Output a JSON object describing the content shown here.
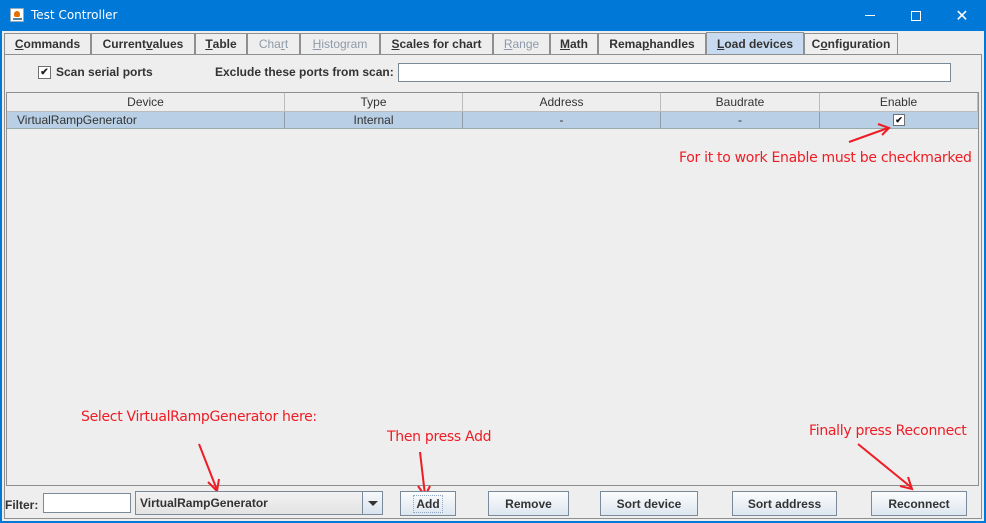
{
  "window": {
    "title": "Test Controller",
    "controls": {
      "minimize": "minimize",
      "maximize": "maximize",
      "close": "✕"
    }
  },
  "tabs": [
    {
      "label": "Commands",
      "mnemonic_index": 0,
      "state": "normal"
    },
    {
      "label": "Current values",
      "mnemonic_index": 8,
      "state": "normal"
    },
    {
      "label": "Table",
      "mnemonic_index": 0,
      "state": "normal"
    },
    {
      "label": "Chart",
      "mnemonic_index": 3,
      "state": "disabled"
    },
    {
      "label": "Histogram",
      "mnemonic_index": 0,
      "state": "disabled"
    },
    {
      "label": "Scales for chart",
      "mnemonic_index": 0,
      "state": "normal"
    },
    {
      "label": "Range",
      "mnemonic_index": 0,
      "state": "disabled"
    },
    {
      "label": "Math",
      "mnemonic_index": 0,
      "state": "normal"
    },
    {
      "label": "Remap handles",
      "mnemonic_index": 4,
      "state": "normal"
    },
    {
      "label": "Load devices",
      "mnemonic_index": 0,
      "state": "active"
    },
    {
      "label": "Configuration",
      "mnemonic_index": 1,
      "state": "normal"
    }
  ],
  "scan": {
    "checkbox_label": "Scan serial ports",
    "checked": true,
    "check_glyph": "✔",
    "exclude_label": "Exclude these ports from scan:",
    "exclude_value": ""
  },
  "table": {
    "columns": [
      "Device",
      "Type",
      "Address",
      "Baudrate",
      "Enable"
    ],
    "rows": [
      {
        "device": "VirtualRampGenerator",
        "type": "Internal",
        "address": "-",
        "baudrate": "-",
        "enable": true,
        "selected": true
      }
    ]
  },
  "annotations": {
    "enable_note": "For it to work Enable must be checkmarked",
    "select_note": "Select VirtualRampGenerator here:",
    "add_note": "Then press Add",
    "reconnect_note": "Finally press Reconnect",
    "color": "#ee1c24"
  },
  "bottom": {
    "filter_label": "Filter:",
    "filter_value": "",
    "device_combo_value": "VirtualRampGenerator",
    "buttons": {
      "add": "Add",
      "remove": "Remove",
      "sort_device": "Sort device",
      "sort_address": "Sort address",
      "reconnect": "Reconnect"
    }
  }
}
